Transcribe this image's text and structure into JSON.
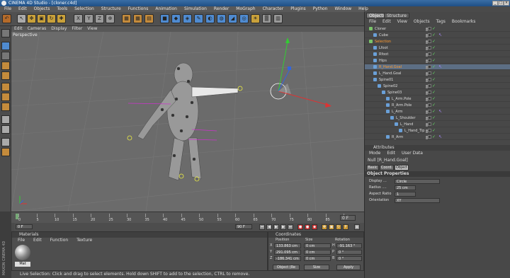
{
  "window": {
    "title": "CINEMA 4D Studio - [cloner.c4d]",
    "min": "_",
    "max": "□",
    "close": "×"
  },
  "menubar": [
    "File",
    "Edit",
    "Objects",
    "Tools",
    "Selection",
    "Structure",
    "Functions",
    "Animation",
    "Simulation",
    "Render",
    "MoGraph",
    "Character",
    "Plugins",
    "Python",
    "Window",
    "Help"
  ],
  "viewport": {
    "menu": [
      "Edit",
      "Cameras",
      "Display",
      "Filter",
      "View"
    ],
    "label": "Perspective"
  },
  "timeline": {
    "ticks": [
      "0",
      "5",
      "10",
      "15",
      "20",
      "25",
      "30",
      "35",
      "40",
      "45",
      "50",
      "55",
      "60",
      "65",
      "70",
      "75",
      "80",
      "85",
      "90"
    ],
    "frame_end": "0 F",
    "start": "0 F",
    "end": "90 F"
  },
  "materials": {
    "title": "Materials",
    "menu": [
      "File",
      "Edit",
      "Function",
      "Texture"
    ],
    "mat_name": "Mat"
  },
  "coordinates": {
    "title": "Coordinates",
    "headers": [
      "Position",
      "Size",
      "Rotation"
    ],
    "rows": [
      {
        "axis": "X",
        "pos": "133.863 cm",
        "size": "0 cm",
        "rlabel": "H",
        "rot": "-91.163 °"
      },
      {
        "axis": "Y",
        "pos": "291.095 cm",
        "size": "0 cm",
        "rlabel": "P",
        "rot": "0 °"
      },
      {
        "axis": "Z",
        "pos": "-186.341 cm",
        "size": "0 cm",
        "rlabel": "B",
        "rot": "0 °"
      }
    ],
    "mode": "Object (Re",
    "size_mode": "Size",
    "apply": "Apply"
  },
  "status": "Live Selection: Click and drag to select elements. Hold down SHIFT to add to the selection, CTRL to remove.",
  "maxon": "MAXON CINEMA 4D",
  "objects": {
    "tabs": [
      "Objects",
      "Structure"
    ],
    "menu": [
      "File",
      "Edit",
      "View",
      "Objects",
      "Tags",
      "Bookmarks"
    ],
    "rows": [
      {
        "name": "Cloner",
        "indent": 0
      },
      {
        "name": "Cube",
        "indent": 1
      },
      {
        "name": "Selection",
        "indent": 0,
        "hl": true
      },
      {
        "name": "Lfoot",
        "indent": 1
      },
      {
        "name": "Rfoot",
        "indent": 1
      },
      {
        "name": "Hips",
        "indent": 1
      },
      {
        "name": "R_Hand.Goal",
        "indent": 1,
        "hl": true
      },
      {
        "name": "L_Hand.Goal",
        "indent": 1
      },
      {
        "name": "Spine01",
        "indent": 1
      },
      {
        "name": "Spine02",
        "indent": 2
      },
      {
        "name": "Spine03",
        "indent": 3
      },
      {
        "name": "L_Arm.Pole",
        "indent": 4
      },
      {
        "name": "R_Arm.Pole",
        "indent": 4
      },
      {
        "name": "L_Arm",
        "indent": 4
      },
      {
        "name": "L_Shoulder",
        "indent": 5
      },
      {
        "name": "L_Hand",
        "indent": 6
      },
      {
        "name": "L_Hand_Tip",
        "indent": 7
      },
      {
        "name": "R_Arm",
        "indent": 4
      }
    ]
  },
  "attributes": {
    "title": "Attributes",
    "menu": [
      "Mode",
      "Edit",
      "User Data"
    ],
    "object_name": "Null [R_Hand.Goal]",
    "tabs": [
      "Basic",
      "Coord.",
      "Object"
    ],
    "section": "Object Properties",
    "fields": [
      {
        "label": "Display ...",
        "value": "Circle"
      },
      {
        "label": "Radius ....",
        "value": "25 cm"
      },
      {
        "label": "Aspect Ratio",
        "value": "1"
      },
      {
        "label": "Orientation",
        "value": "XY"
      }
    ]
  }
}
